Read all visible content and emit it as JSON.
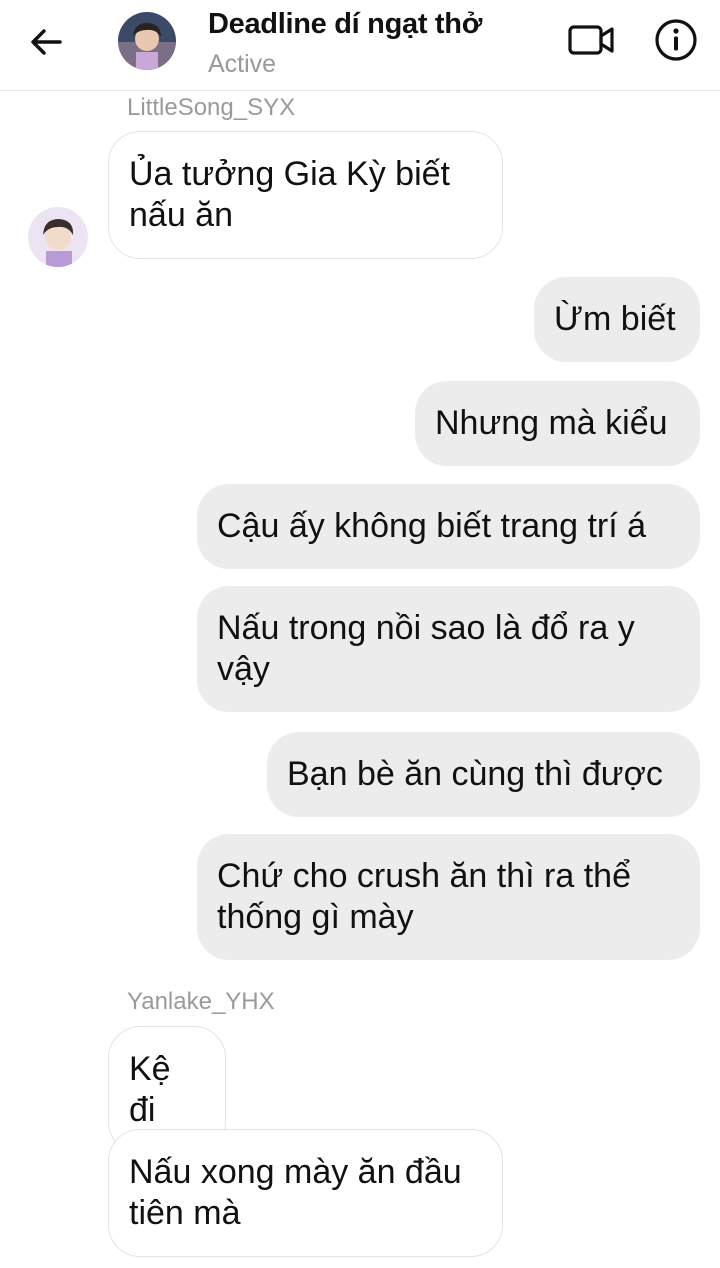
{
  "header": {
    "title": "Deadline dí ngạt thở",
    "status": "Active",
    "icons": {
      "back": "arrow-left-icon",
      "video": "video-call-icon",
      "info": "info-icon"
    }
  },
  "messages": [
    {
      "type": "sender",
      "text": "LittleSong_SYX"
    },
    {
      "type": "incoming",
      "text": "Ủa tưởng Gia Kỳ biết nấu ăn"
    },
    {
      "type": "outgoing",
      "text": "Ừm biết"
    },
    {
      "type": "outgoing",
      "text": "Nhưng mà kiểu"
    },
    {
      "type": "outgoing",
      "text": "Cậu ấy không biết trang trí á"
    },
    {
      "type": "outgoing",
      "text": "Nấu trong nồi sao là đổ ra y vậy"
    },
    {
      "type": "outgoing",
      "text": "Bạn bè ăn cùng thì được"
    },
    {
      "type": "outgoing",
      "text": "Chứ cho crush ăn thì ra thể thống gì mày"
    },
    {
      "type": "sender",
      "text": "Yanlake_YHX"
    },
    {
      "type": "incoming",
      "text": "Kệ đi"
    },
    {
      "type": "incoming",
      "text": "Nấu xong mày ăn đầu tiên mà"
    }
  ],
  "colors": {
    "incoming_bubble": "#ffffff",
    "outgoing_bubble": "#ececec",
    "muted_text": "#999999"
  }
}
